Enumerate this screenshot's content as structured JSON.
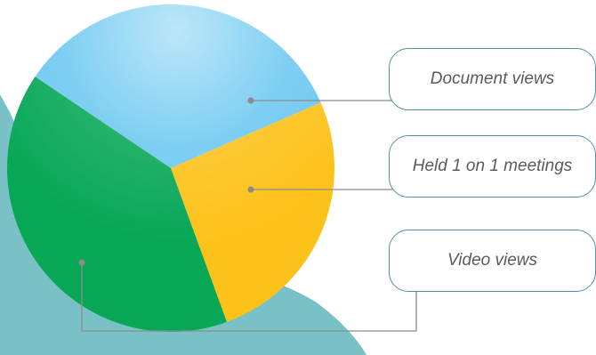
{
  "chart_data": {
    "type": "pie",
    "title": "",
    "slices": [
      {
        "label": "Document views",
        "value": 34,
        "color": "#6cc8f0"
      },
      {
        "label": "Held 1 on 1 meetings",
        "value": 26,
        "color": "#fdc21a"
      },
      {
        "label": "Video views",
        "value": 40,
        "color": "#07a756"
      }
    ],
    "legend": "callout boxes on the right",
    "background_shape_color": "#79c1c7",
    "leader_line_color": "#8c8c8c"
  }
}
